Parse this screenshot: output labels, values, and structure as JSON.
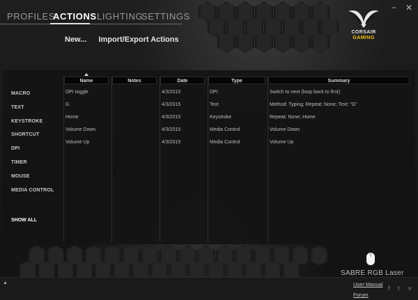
{
  "window": {
    "minimize": "−",
    "close": "✕"
  },
  "nav": {
    "tabs": [
      {
        "label": "PROFILES"
      },
      {
        "label": "ACTIONS"
      },
      {
        "label": "LIGHTING"
      },
      {
        "label": "SETTINGS"
      }
    ],
    "active_tab": "ACTIONS"
  },
  "subnav": {
    "new": "New...",
    "import_export": "Import/Export Actions"
  },
  "logo": {
    "line1": "CORSAIR",
    "line2": "GAMING",
    "accent": "#f3c21a"
  },
  "sidebar": {
    "items": [
      "MACRO",
      "TEXT",
      "KEYSTROKE",
      "SHORTCUT",
      "DPI",
      "TIMER",
      "MOUSE",
      "MEDIA CONTROL"
    ],
    "show_all": "SHOW ALL"
  },
  "table": {
    "columns": [
      "Name",
      "Notes",
      "Date",
      "Type",
      "Summary"
    ],
    "rows": [
      {
        "name": "DPI toggle",
        "notes": "",
        "date": "4/3/2015",
        "type": "DPI",
        "summary": "Switch to next (loop back to first)"
      },
      {
        "name": "G",
        "notes": "",
        "date": "4/3/2015",
        "type": "Text",
        "summary": "Method: Typing; Repeat: None; Text: \"G\""
      },
      {
        "name": "Home",
        "notes": "",
        "date": "4/3/2015",
        "type": "Keystroke",
        "summary": "Repeat: None; Home"
      },
      {
        "name": "Volume Down",
        "notes": "",
        "date": "4/3/2015",
        "type": "Media Control",
        "summary": "Volume Down"
      },
      {
        "name": "Volume Up",
        "notes": "",
        "date": "4/3/2015",
        "type": "Media Control",
        "summary": "Volume Up"
      }
    ]
  },
  "device": {
    "name": "SABRE RGB Laser",
    "icon": "mouse-icon"
  },
  "footer": {
    "expand": "▲",
    "user_manual": "User Manual",
    "forum": "Forum",
    "social": [
      "f",
      "t",
      "v"
    ]
  }
}
